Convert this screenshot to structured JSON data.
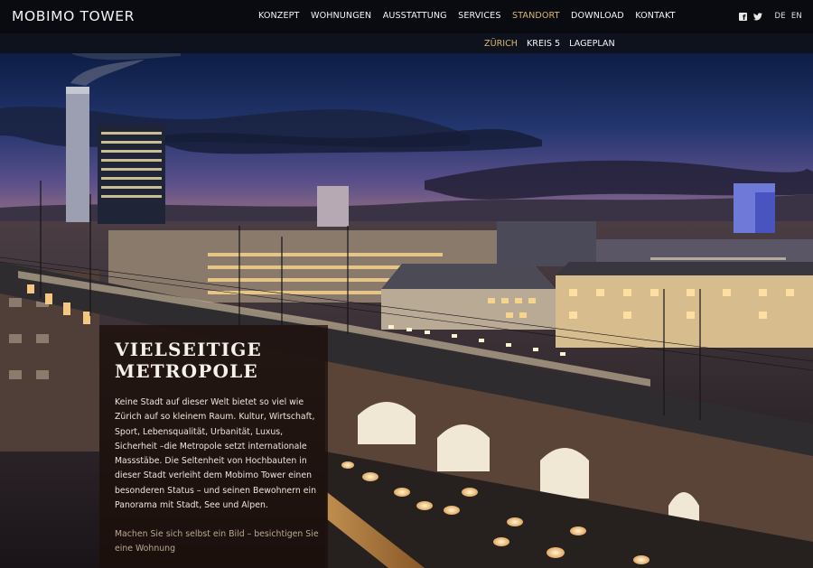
{
  "brand": {
    "logo": "MOBIMO TOWER"
  },
  "main_nav": {
    "items": [
      {
        "label": "KONZEPT"
      },
      {
        "label": "WOHNUNGEN"
      },
      {
        "label": "AUSSTATTUNG"
      },
      {
        "label": "SERVICES"
      },
      {
        "label": "STANDORT",
        "active": true
      },
      {
        "label": "DOWNLOAD"
      },
      {
        "label": "KONTAKT"
      }
    ]
  },
  "social": {
    "facebook_icon": "facebook-icon",
    "twitter_icon": "twitter-icon"
  },
  "languages": {
    "de": "DE",
    "en": "EN"
  },
  "sub_nav": {
    "items": [
      {
        "label": "ZÜRICH",
        "active": true
      },
      {
        "label": "KREIS 5"
      },
      {
        "label": "LAGEPLAN"
      }
    ]
  },
  "content": {
    "headline_line1": "VIELSEITIGE",
    "headline_line2": "METROPOLE",
    "body": "Keine Stadt auf dieser Welt bietet so viel wie Zürich auf so kleinem Raum. Kultur, Wirtschaft, Sport, Lebensqualität, Urbanität, Luxus, Sicherheit –die Metropole setzt internationale Massstäbe. Die Seltenheit von Hochbauten in dieser Stadt verleiht dem Mobimo Tower einen besonderen Status – und seinen Bewohnern ein Panorama mit Stadt, See und Alpen.",
    "cta": "Machen Sie sich selbst ein Bild – besichtigen Sie eine Wohnung"
  },
  "colors": {
    "accent": "#d9b86c",
    "topbar": "#090b10",
    "panel": "#1c100a"
  }
}
